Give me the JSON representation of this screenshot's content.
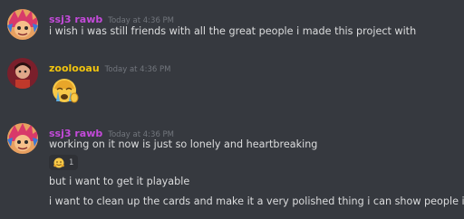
{
  "colors": {
    "background": "#36393f",
    "user1_name": "#c34ad9",
    "user2_name": "#f1c40f",
    "timestamp": "#72767d",
    "text": "#dcddde"
  },
  "messages": [
    {
      "username": "ssj3 rawb",
      "timestamp": "Today at 4:36 PM",
      "lines": [
        "i wish i was still friends with all the great people i made this project with"
      ]
    },
    {
      "username": "zoolooau",
      "timestamp": "Today at 4:36 PM",
      "emoji": "crying-emoji-icon"
    },
    {
      "username": "ssj3 rawb",
      "timestamp": "Today at 4:36 PM",
      "lines": [
        "working on it now is just so lonely and heartbreaking",
        "but i want to get it playable",
        "i want to clean up the cards and make it a very polished thing i can show people i did"
      ],
      "reaction": {
        "icon": "hugging-emoji-icon",
        "count": "1"
      }
    }
  ]
}
